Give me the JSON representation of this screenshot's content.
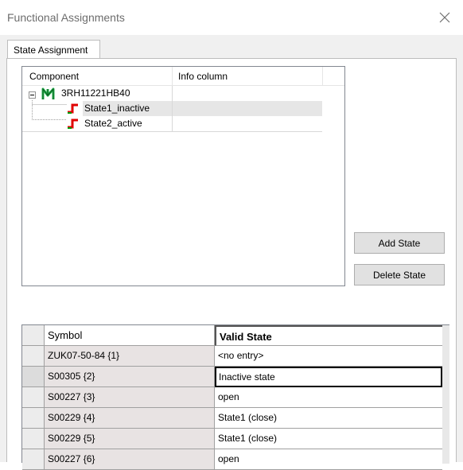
{
  "window": {
    "title": "Functional Assignments",
    "close_icon": "close-icon"
  },
  "tabs": [
    {
      "label": "State Assignment",
      "active": true
    }
  ],
  "tree": {
    "columns": [
      "Component",
      "Info column"
    ],
    "component": {
      "label": "3RH11221HB40",
      "icon": "component-icon",
      "expanded": true
    },
    "states": [
      {
        "label": "State1_inactive",
        "icon": "state-icon",
        "selected": true
      },
      {
        "label": "State2_active",
        "icon": "state-icon",
        "selected": false
      }
    ]
  },
  "buttons": {
    "add_state": "Add State",
    "delete_state": "Delete State"
  },
  "grid": {
    "columns": [
      "Symbol",
      "Valid State"
    ],
    "rows": [
      {
        "symbol": "ZUK07-50-84 {1}",
        "valid_state": "<no entry>"
      },
      {
        "symbol": "S00305 {2}",
        "valid_state": "Inactive state"
      },
      {
        "symbol": "S00227 {3}",
        "valid_state": "open"
      },
      {
        "symbol": "S00229 {4}",
        "valid_state": "State1 (close)"
      },
      {
        "symbol": "S00229 {5}",
        "valid_state": "State1 (close)"
      },
      {
        "symbol": "S00227 {6}",
        "valid_state": "open"
      }
    ],
    "current_row": 2
  },
  "colors": {
    "title_text": "#6d6d6d",
    "component_icon": "#22b14c",
    "state_icon_red": "#e00000",
    "state_icon_green": "#00a000",
    "grid_empty": "#aaaaaa"
  }
}
